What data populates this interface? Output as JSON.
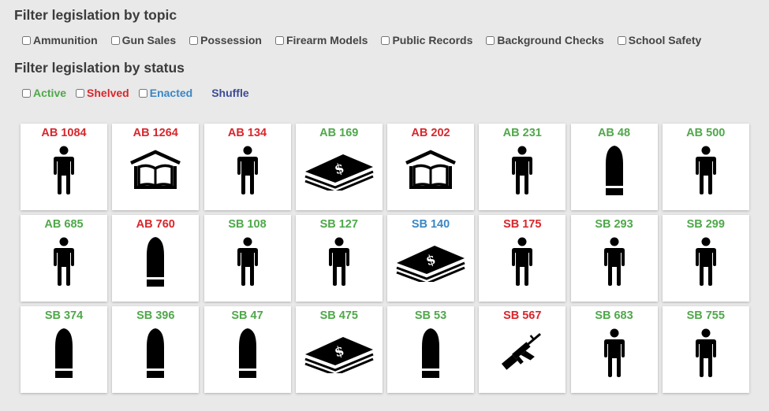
{
  "topic_heading": "Filter legislation by topic",
  "status_heading": "Filter legislation by status",
  "topics": [
    {
      "label": "Ammunition"
    },
    {
      "label": "Gun Sales"
    },
    {
      "label": "Possession"
    },
    {
      "label": "Firearm Models"
    },
    {
      "label": "Public Records"
    },
    {
      "label": "Background Checks"
    },
    {
      "label": "School Safety"
    }
  ],
  "statuses": [
    {
      "label": "Active",
      "status": "active"
    },
    {
      "label": "Shelved",
      "status": "shelved"
    },
    {
      "label": "Enacted",
      "status": "enacted"
    }
  ],
  "shuffle_label": "Shuffle",
  "colors": {
    "active": "#4fa84a",
    "shelved": "#d9262b",
    "enacted": "#3a86c5",
    "shuffle": "#3b4a96"
  },
  "bills": [
    {
      "label": "AB 1084",
      "status": "shelved",
      "icon": "person"
    },
    {
      "label": "AB 1264",
      "status": "shelved",
      "icon": "school"
    },
    {
      "label": "AB 134",
      "status": "shelved",
      "icon": "person"
    },
    {
      "label": "AB 169",
      "status": "active",
      "icon": "money"
    },
    {
      "label": "AB 202",
      "status": "shelved",
      "icon": "school"
    },
    {
      "label": "AB 231",
      "status": "active",
      "icon": "person"
    },
    {
      "label": "AB 48",
      "status": "active",
      "icon": "bullet"
    },
    {
      "label": "AB 500",
      "status": "active",
      "icon": "person"
    },
    {
      "label": "AB 685",
      "status": "active",
      "icon": "person"
    },
    {
      "label": "AB 760",
      "status": "shelved",
      "icon": "bullet"
    },
    {
      "label": "SB 108",
      "status": "active",
      "icon": "person"
    },
    {
      "label": "SB 127",
      "status": "active",
      "icon": "person"
    },
    {
      "label": "SB 140",
      "status": "enacted",
      "icon": "money"
    },
    {
      "label": "SB 175",
      "status": "shelved",
      "icon": "person"
    },
    {
      "label": "SB 293",
      "status": "active",
      "icon": "person"
    },
    {
      "label": "SB 299",
      "status": "active",
      "icon": "person"
    },
    {
      "label": "SB 374",
      "status": "active",
      "icon": "bullet"
    },
    {
      "label": "SB 396",
      "status": "active",
      "icon": "bullet"
    },
    {
      "label": "SB 47",
      "status": "active",
      "icon": "bullet"
    },
    {
      "label": "SB 475",
      "status": "active",
      "icon": "money"
    },
    {
      "label": "SB 53",
      "status": "active",
      "icon": "bullet"
    },
    {
      "label": "SB 567",
      "status": "shelved",
      "icon": "rifle"
    },
    {
      "label": "SB 683",
      "status": "active",
      "icon": "person"
    },
    {
      "label": "SB 755",
      "status": "active",
      "icon": "person"
    }
  ]
}
